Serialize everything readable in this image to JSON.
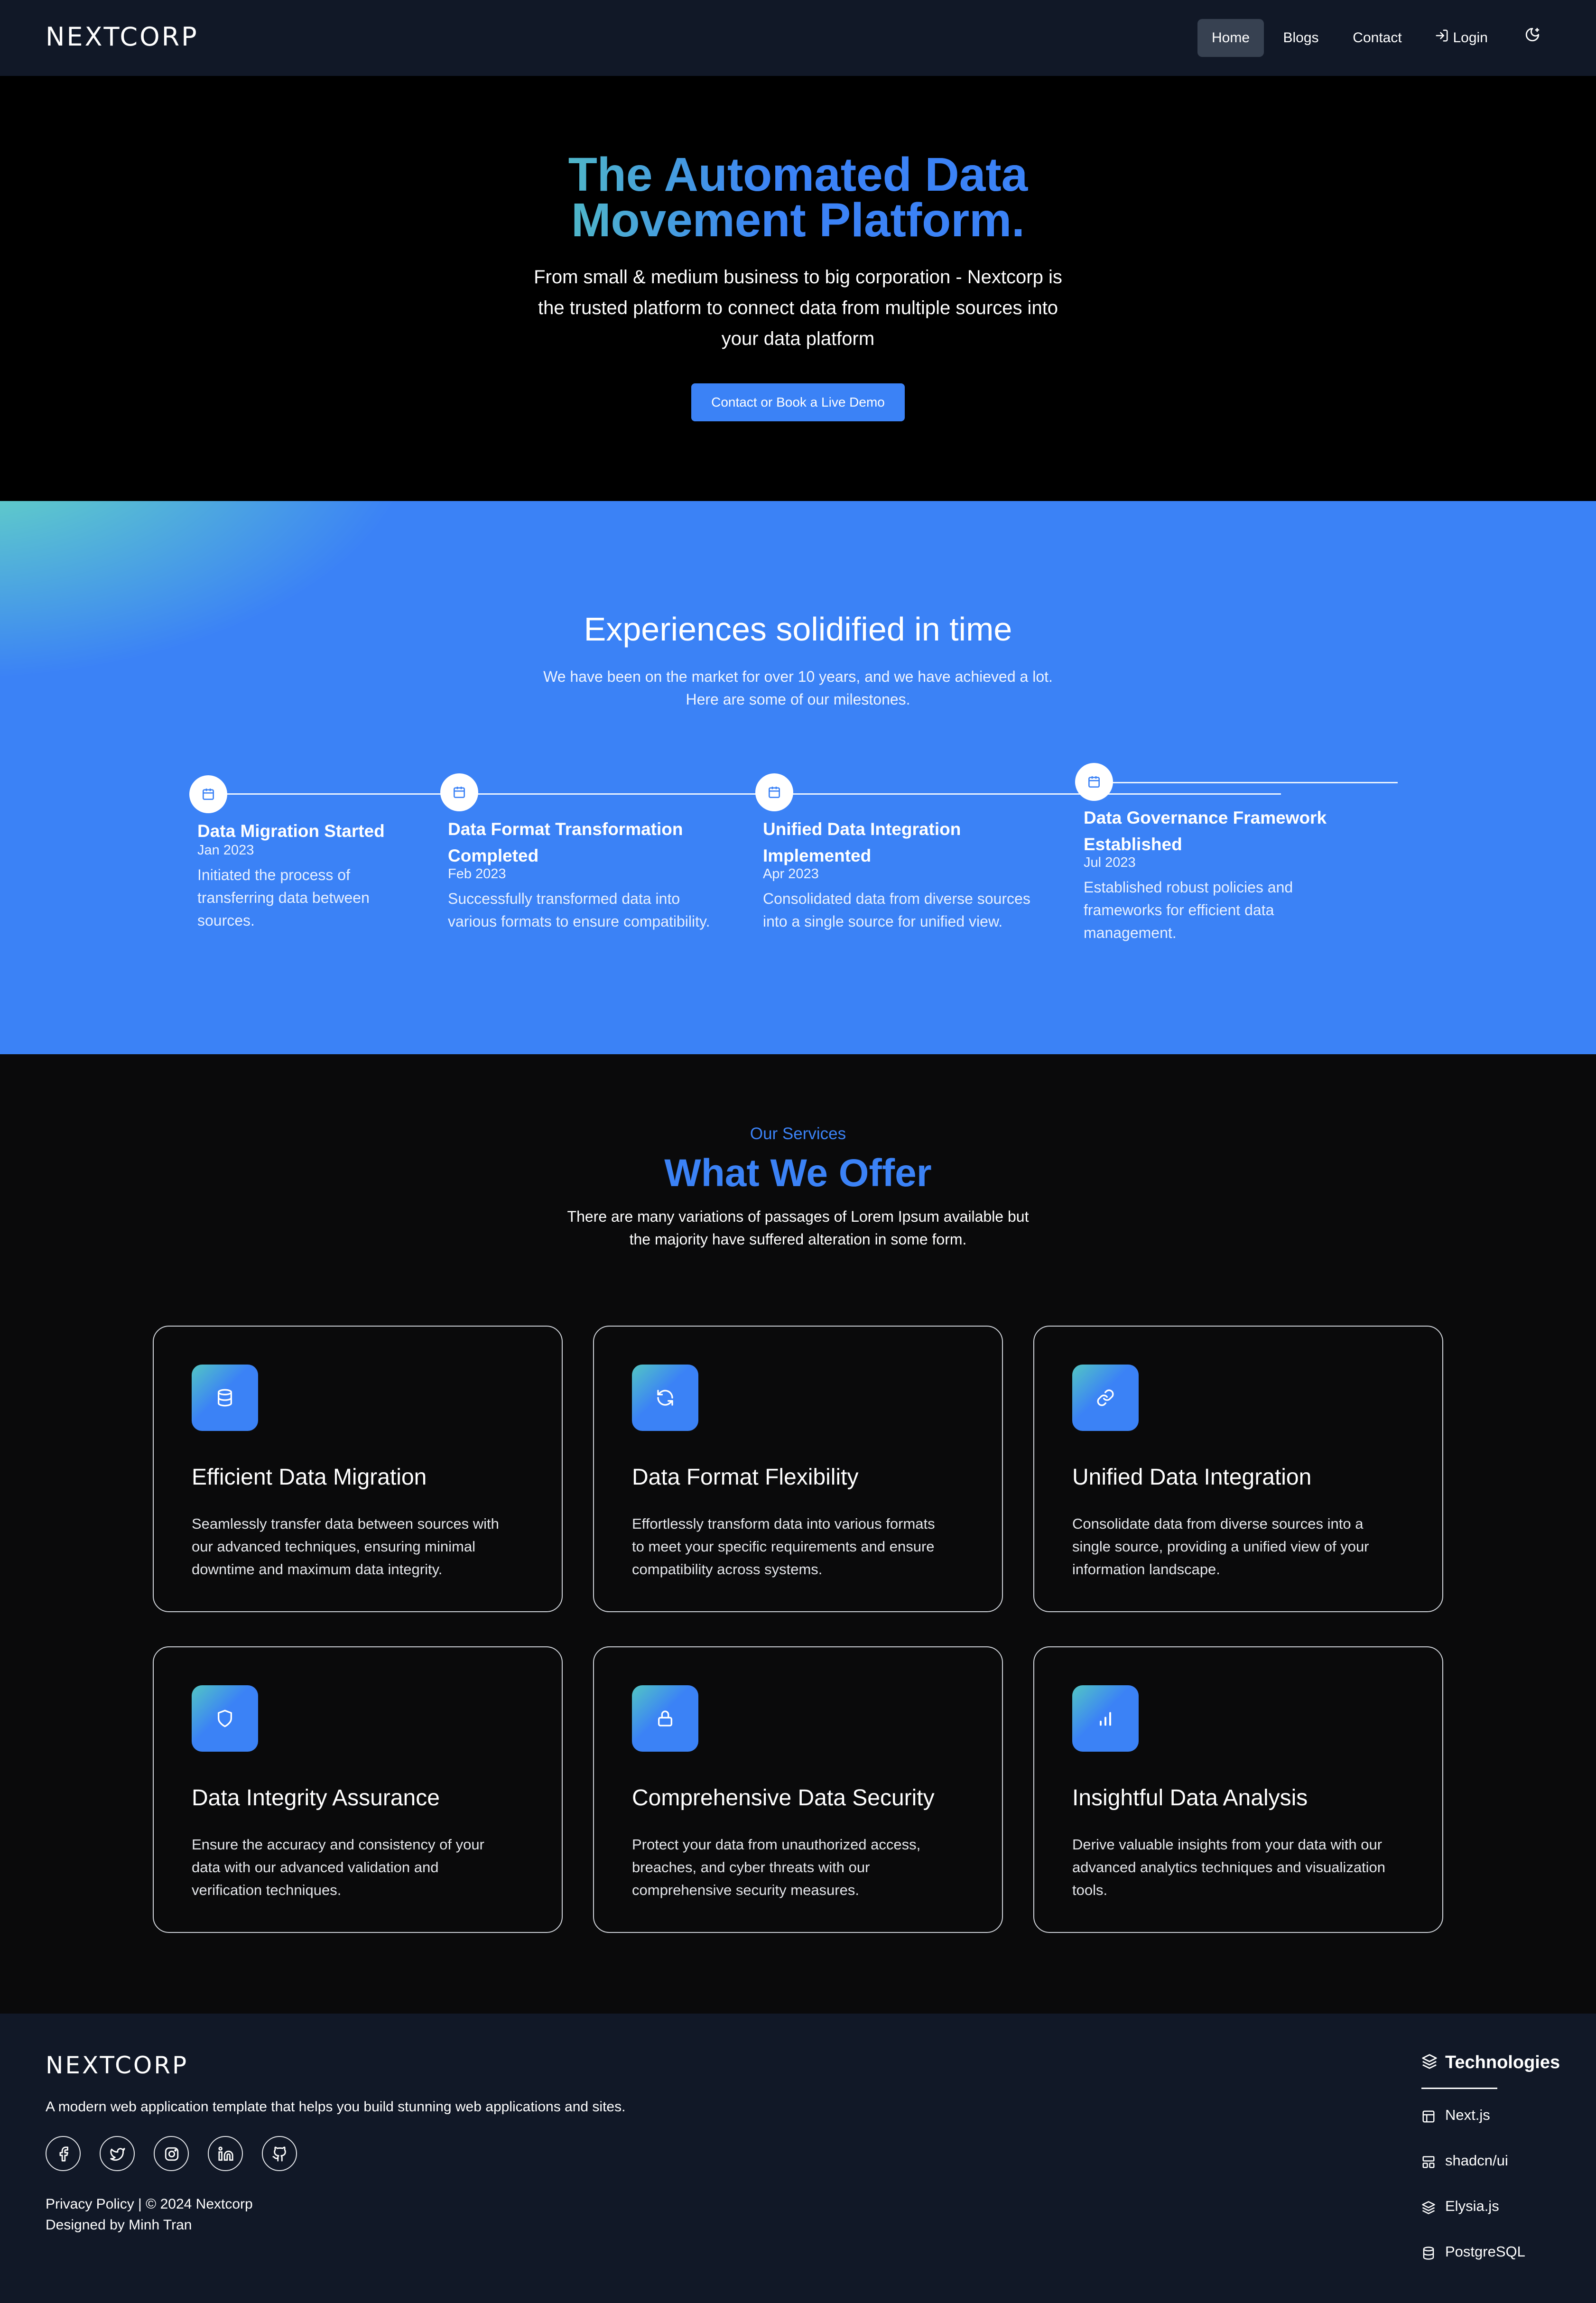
{
  "nav": {
    "logo": "NEXTCORP",
    "items": [
      {
        "label": "Home",
        "active": true
      },
      {
        "label": "Blogs"
      },
      {
        "label": "Contact"
      },
      {
        "label": "Login",
        "icon": "login-icon"
      }
    ],
    "theme_toggle_icon": "moon-icon"
  },
  "hero": {
    "title_line1": "The Automated Data",
    "title_line2": "Movement Platform.",
    "subtitle": "From small & medium business to big corporation - Nextcorp is the trusted platform to connect data from multiple sources into your data platform",
    "cta_label": "Contact or Book a Live Demo"
  },
  "milestones": {
    "title": "Experiences solidified in time",
    "subtitle_line1": "We have been on the market for over 10 years, and we have achieved a lot.",
    "subtitle_line2": "Here are some of our milestones.",
    "items": [
      {
        "title_line1": "Data Migration Started",
        "title_line2": "",
        "date": "Jan 2023",
        "desc_lines": [
          "Initiated the process of",
          "transferring data between",
          "sources."
        ],
        "icon": "calendar-icon"
      },
      {
        "title_line1": "Data Format Transformation",
        "title_line2": "Completed",
        "date": "Feb 2023",
        "desc_lines": [
          "Successfully transformed data into",
          "various formats to ensure compatibility."
        ],
        "icon": "calendar-icon"
      },
      {
        "title_line1": "Unified Data Integration",
        "title_line2": "Implemented",
        "date": "Apr 2023",
        "desc_lines": [
          "Consolidated data from diverse sources",
          "into a single source for unified view."
        ],
        "icon": "calendar-icon"
      },
      {
        "title_line1": "Data Governance Framework",
        "title_line2": "Established",
        "date": "Jul 2023",
        "desc_lines": [
          "Established robust policies and",
          "frameworks for efficient data",
          "management."
        ],
        "icon": "calendar-icon"
      }
    ]
  },
  "services": {
    "kicker": "Our Services",
    "title": "What We Offer",
    "subtitle_line1": "There are many variations of passages of Lorem Ipsum available but",
    "subtitle_line2": "the majority have suffered alteration in some form.",
    "cards": [
      {
        "title": "Efficient Data Migration",
        "icon": "database-icon",
        "desc_lines": [
          "Seamlessly transfer data between sources with",
          "our advanced techniques, ensuring minimal",
          "downtime and maximum data integrity."
        ]
      },
      {
        "title": "Data Format Flexibility",
        "icon": "refresh-icon",
        "desc_lines": [
          "Effortlessly transform data into various formats",
          "to meet your specific requirements and ensure",
          "compatibility across systems."
        ]
      },
      {
        "title": "Unified Data Integration",
        "icon": "link-icon",
        "desc_lines": [
          "Consolidate data from diverse sources into a",
          "single source, providing a unified view of your",
          "information landscape."
        ]
      },
      {
        "title": "Data Integrity Assurance",
        "icon": "shield-icon",
        "desc_lines": [
          "Ensure the accuracy and consistency of your",
          "data with our advanced validation and",
          "verification techniques."
        ]
      },
      {
        "title": "Comprehensive Data Security",
        "icon": "lock-icon",
        "desc_lines": [
          "Protect your data from unauthorized access,",
          "breaches, and cyber threats with our",
          "comprehensive security measures."
        ]
      },
      {
        "title": "Insightful Data Analysis",
        "icon": "bar-chart-icon",
        "desc_lines": [
          "Derive valuable insights from your data with our",
          "advanced analytics techniques and visualization",
          "tools."
        ]
      }
    ]
  },
  "footer": {
    "logo": "NEXTCORP",
    "tagline": "A modern web application template that helps you build stunning web applications and sites.",
    "socials": [
      "facebook-icon",
      "twitter-icon",
      "instagram-icon",
      "linkedin-icon",
      "github-icon"
    ],
    "legal_line1": "Privacy Policy | © 2024 Nextcorp",
    "legal_line2": "Designed by Minh Tran",
    "tech_title": "Technologies",
    "tech_items": [
      {
        "label": "Next.js",
        "icon": "layout-icon"
      },
      {
        "label": "shadcn/ui",
        "icon": "components-icon"
      },
      {
        "label": "Elysia.js",
        "icon": "layers-icon"
      },
      {
        "label": "PostgreSQL",
        "icon": "database-icon"
      }
    ]
  },
  "colors": {
    "accent": "#3b82f6",
    "nav_bg": "#111827",
    "gradient_start": "#6ee7b7"
  }
}
